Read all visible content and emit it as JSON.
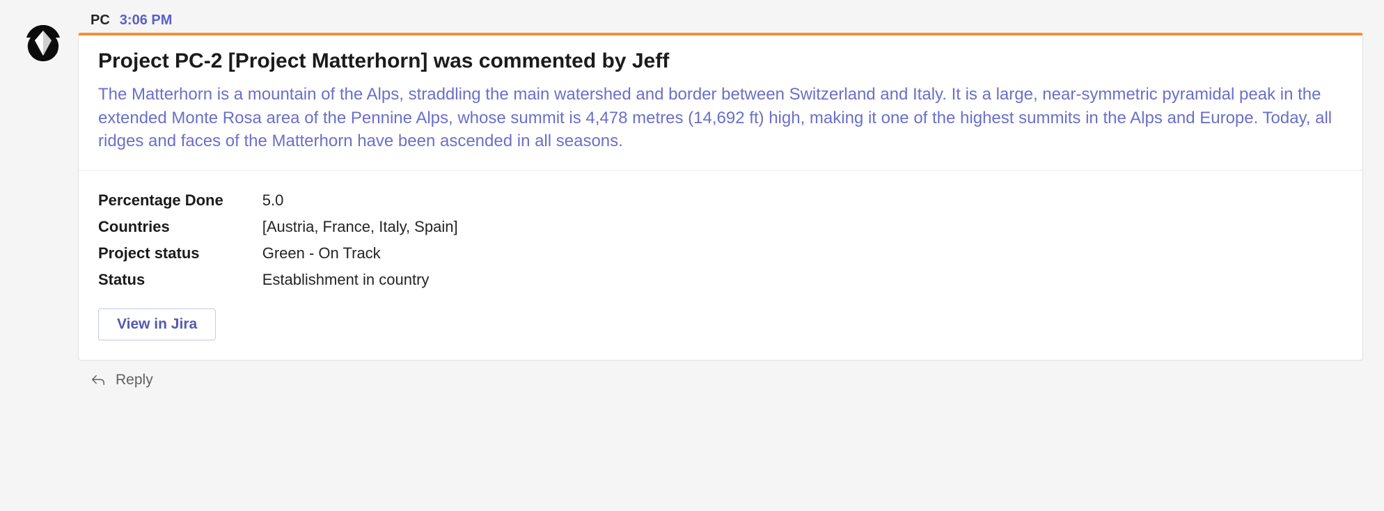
{
  "sender": "PC",
  "timestamp": "3:06 PM",
  "card": {
    "title": "Project PC-2 [Project Matterhorn] was commented by Jeff",
    "description": "The Matterhorn is a mountain of the Alps, straddling the main watershed and border between Switzerland and Italy.   It is a large, near-symmetric pyramidal peak in the extended Monte Rosa area of the Pennine Alps, whose summit is 4,478 metres (14,692 ft) high, making it one of the highest summits in the Alps and Europe.   Today, all ridges and faces of the Matterhorn have been ascended in all seasons.",
    "fields": [
      {
        "label": "Percentage Done",
        "value": "5.0"
      },
      {
        "label": "Countries",
        "value": "[Austria, France, Italy, Spain]"
      },
      {
        "label": "Project status",
        "value": "Green - On Track"
      },
      {
        "label": "Status",
        "value": "Establishment in country"
      }
    ],
    "action_label": "View in Jira"
  },
  "reply_label": "Reply",
  "colors": {
    "accent_orange": "#f29131",
    "link_purple": "#6b6fc9",
    "button_purple": "#5558b3"
  }
}
